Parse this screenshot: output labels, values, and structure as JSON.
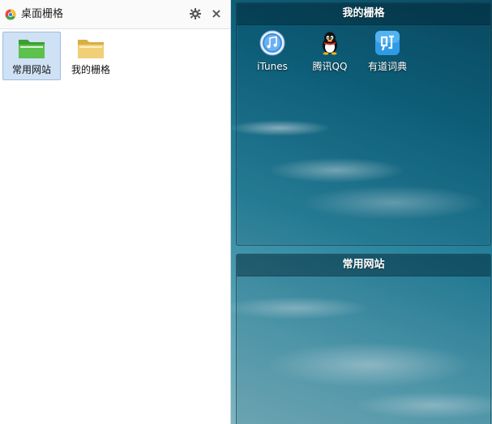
{
  "window": {
    "title": "桌面栅格",
    "icon": "app-logo-icon",
    "settings_icon": "gear-icon",
    "close_symbol": "×"
  },
  "folders": [
    {
      "label": "常用网站",
      "icon": "green-folder-icon",
      "color": "#4cae3c",
      "selected": true
    },
    {
      "label": "我的栅格",
      "icon": "yellow-folder-icon",
      "color": "#e8c25c",
      "selected": false
    }
  ],
  "fences": [
    {
      "title": "我的栅格",
      "shortcuts": [
        {
          "label": "iTunes",
          "icon": "itunes-icon"
        },
        {
          "label": "腾讯QQ",
          "icon": "qq-penguin-icon"
        },
        {
          "label": "有道词典",
          "icon": "youdao-dict-icon"
        }
      ]
    },
    {
      "title": "常用网站",
      "shortcuts": []
    }
  ],
  "colors": {
    "selection_bg": "#cfe1f5",
    "desktop_top": "#0b4c63",
    "desktop_bottom": "#7bb5c2"
  }
}
